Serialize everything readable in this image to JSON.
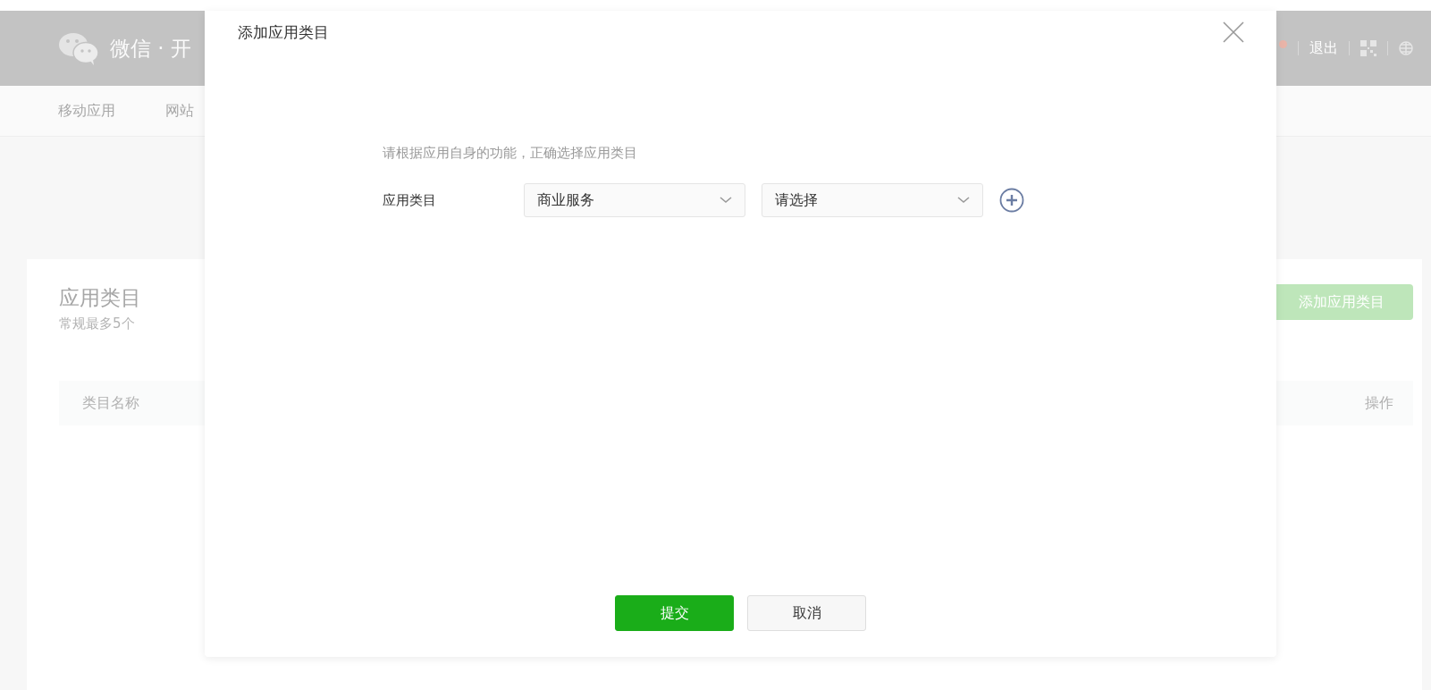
{
  "header": {
    "title": "微信 · 开",
    "notification_dot": true,
    "links": [
      "退出"
    ]
  },
  "nav": {
    "items": [
      "移动应用",
      "网站"
    ]
  },
  "card": {
    "title": "应用类目",
    "subtitle": "常规最多5个",
    "add_button": "添加应用类目",
    "table": {
      "columns": [
        "类目名称",
        "操作"
      ]
    }
  },
  "dialog": {
    "title": "添加应用类目",
    "hint": "请根据应用自身的功能，正确选择应用类目",
    "field_label": "应用类目",
    "selects": [
      {
        "value": "商业服务"
      },
      {
        "placeholder": "请选择"
      }
    ],
    "buttons": [
      {
        "label": "提交",
        "kind": "primary"
      },
      {
        "label": "取消",
        "kind": "default"
      }
    ]
  }
}
